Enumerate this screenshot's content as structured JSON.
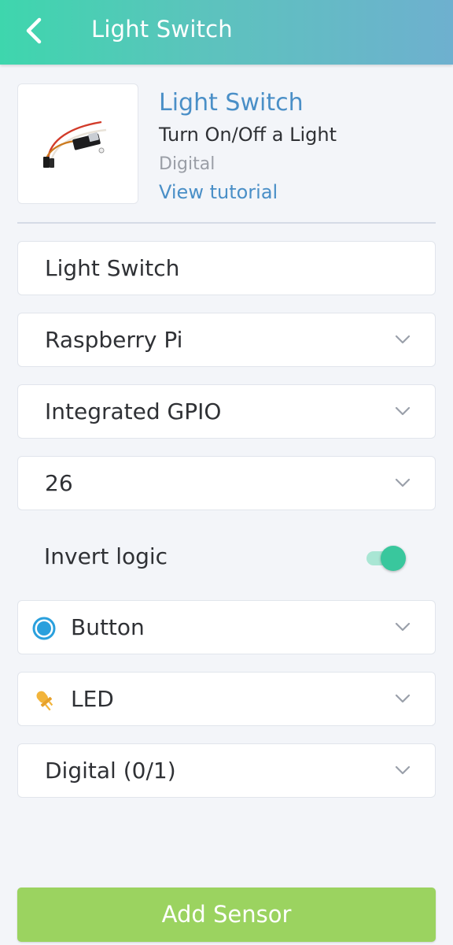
{
  "header": {
    "title": "Light Switch"
  },
  "sensor": {
    "name": "Light Switch",
    "description": "Turn On/Off a Light",
    "type": "Digital",
    "tutorial_link": "View tutorial"
  },
  "form": {
    "name_value": "Light Switch",
    "device_value": "Raspberry Pi",
    "connectivity_value": "Integrated GPIO",
    "pin_value": "26",
    "invert_logic_label": "Invert logic",
    "invert_logic_enabled": true,
    "widget_value": "Button",
    "icon_value": "LED",
    "data_type_value": "Digital (0/1)"
  },
  "footer": {
    "add_button_label": "Add Sensor"
  },
  "colors": {
    "accent_link": "#4a8fc7",
    "toggle_on": "#39c79d",
    "add_button": "#9bd360",
    "button_icon": "#2aa0dd",
    "led_icon": "#f2b43b"
  },
  "icons": {
    "back": "chevron-left-icon",
    "widget": "button-circle-icon",
    "led": "led-icon",
    "dropdown": "chevron-down-icon"
  }
}
